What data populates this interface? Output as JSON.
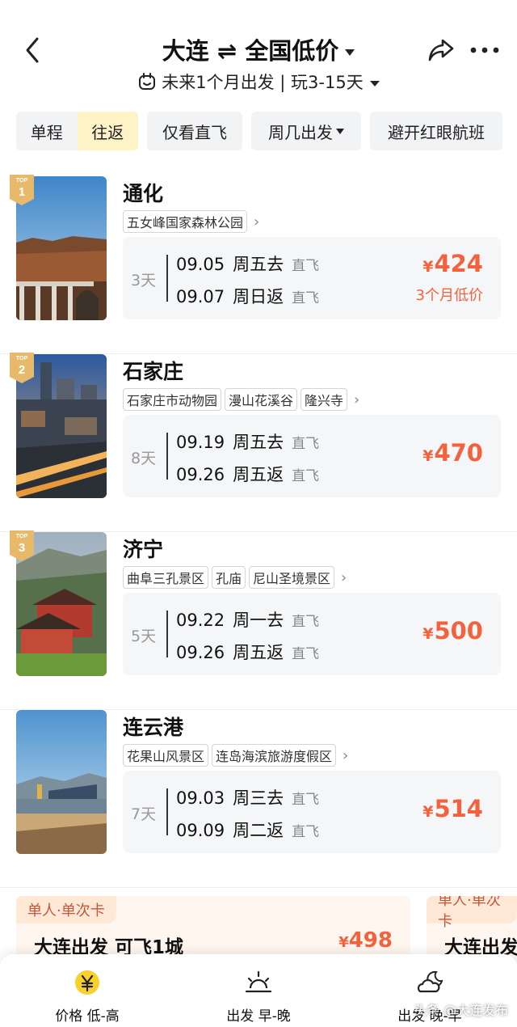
{
  "header": {
    "title": "大连 ⇌ 全国低价",
    "subtitle": "未来1个月出发 | 玩3-15天"
  },
  "filters": {
    "one_way": "单程",
    "round_trip": "往返",
    "direct_only": "仅看直飞",
    "weekday": "周几出发",
    "avoid_redeye": "避开红眼航班"
  },
  "cards": [
    {
      "rank": "1",
      "city": "通化",
      "spots": [
        "五女峰国家森林公园"
      ],
      "days": "3天",
      "out_date": "09.05",
      "out_wd": "周五去",
      "out_type": "直飞",
      "ret_date": "09.07",
      "ret_wd": "周日返",
      "ret_type": "直飞",
      "price": "424",
      "tag": "3个月低价"
    },
    {
      "rank": "2",
      "city": "石家庄",
      "spots": [
        "石家庄市动物园",
        "漫山花溪谷",
        "隆兴寺"
      ],
      "days": "8天",
      "out_date": "09.19",
      "out_wd": "周五去",
      "out_type": "直飞",
      "ret_date": "09.26",
      "ret_wd": "周五返",
      "ret_type": "直飞",
      "price": "470"
    },
    {
      "rank": "3",
      "city": "济宁",
      "spots": [
        "曲阜三孔景区",
        "孔庙",
        "尼山圣境景区"
      ],
      "days": "5天",
      "out_date": "09.22",
      "out_wd": "周一去",
      "out_type": "直飞",
      "ret_date": "09.26",
      "ret_wd": "周五返",
      "ret_type": "直飞",
      "price": "500"
    },
    {
      "city": "连云港",
      "spots": [
        "花果山风景区",
        "连岛海滨旅游度假区"
      ],
      "days": "7天",
      "out_date": "09.03",
      "out_wd": "周三去",
      "out_type": "直飞",
      "ret_date": "09.09",
      "ret_wd": "周二返",
      "ret_type": "直飞",
      "price": "514"
    }
  ],
  "rank_prefix": "TOP",
  "currency": "¥",
  "promos": [
    {
      "tag": "单人·单次卡",
      "text": "大连出发 可飞1城",
      "price": "498"
    },
    {
      "tag": "单人·单次卡",
      "text": "大连出发"
    }
  ],
  "bottom_tabs": [
    {
      "label": "价格 低-高",
      "icon": "yen-coin-icon"
    },
    {
      "label": "出发 早-晚",
      "icon": "sunrise-icon"
    },
    {
      "label": "出发 晚-早",
      "icon": "moon-cloud-icon"
    }
  ],
  "watermark": "头条 @大连发布",
  "colors": {
    "accent": "#f3623d",
    "toggle_active": "#fdf3c6",
    "badge": "#e7b96a",
    "coin": "#f7d02c"
  }
}
